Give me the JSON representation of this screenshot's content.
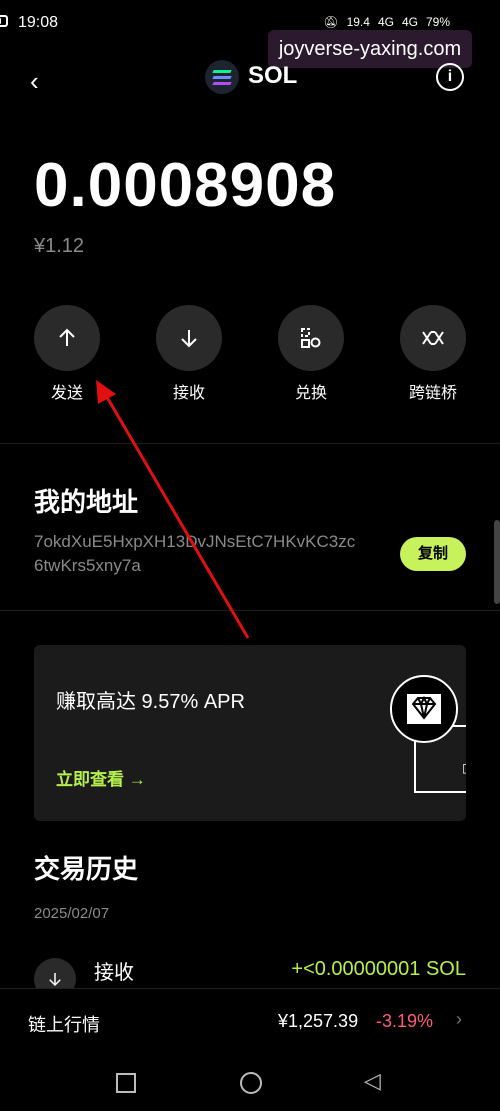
{
  "status_bar": {
    "time": "19:08",
    "network_speed": "19.4",
    "signal_1": "4G",
    "signal_2": "4G",
    "battery": "79%"
  },
  "watermark": "joyverse-yaxing.com",
  "header": {
    "token": "SOL",
    "info_label": "i"
  },
  "balance": {
    "amount": "0.0008908",
    "fiat": "¥1.12"
  },
  "actions": [
    {
      "label": "发送",
      "icon": "arrow-up-icon"
    },
    {
      "label": "接收",
      "icon": "arrow-down-icon"
    },
    {
      "label": "兑换",
      "icon": "swap-icon"
    },
    {
      "label": "跨链桥",
      "icon": "bridge-icon"
    }
  ],
  "address_section": {
    "title": "我的地址",
    "address": "7okdXuE5HxpXH13DvJNsEtC7HKvKC3zc6twKrs5xny7a",
    "copy_label": "复制"
  },
  "promo": {
    "text": "赚取高达 9.57% APR",
    "link": "立即查看 →"
  },
  "history": {
    "title": "交易历史",
    "date": "2025/02/07",
    "items": [
      {
        "type": "接收",
        "amount": "+<0.00000001 SOL"
      }
    ]
  },
  "market": {
    "label": "链上行情",
    "price": "¥1,257.39",
    "change": "-3.19%"
  },
  "colors": {
    "accent": "#c7f25c",
    "negative": "#ff5a7a",
    "annotation_arrow": "#e01010"
  }
}
